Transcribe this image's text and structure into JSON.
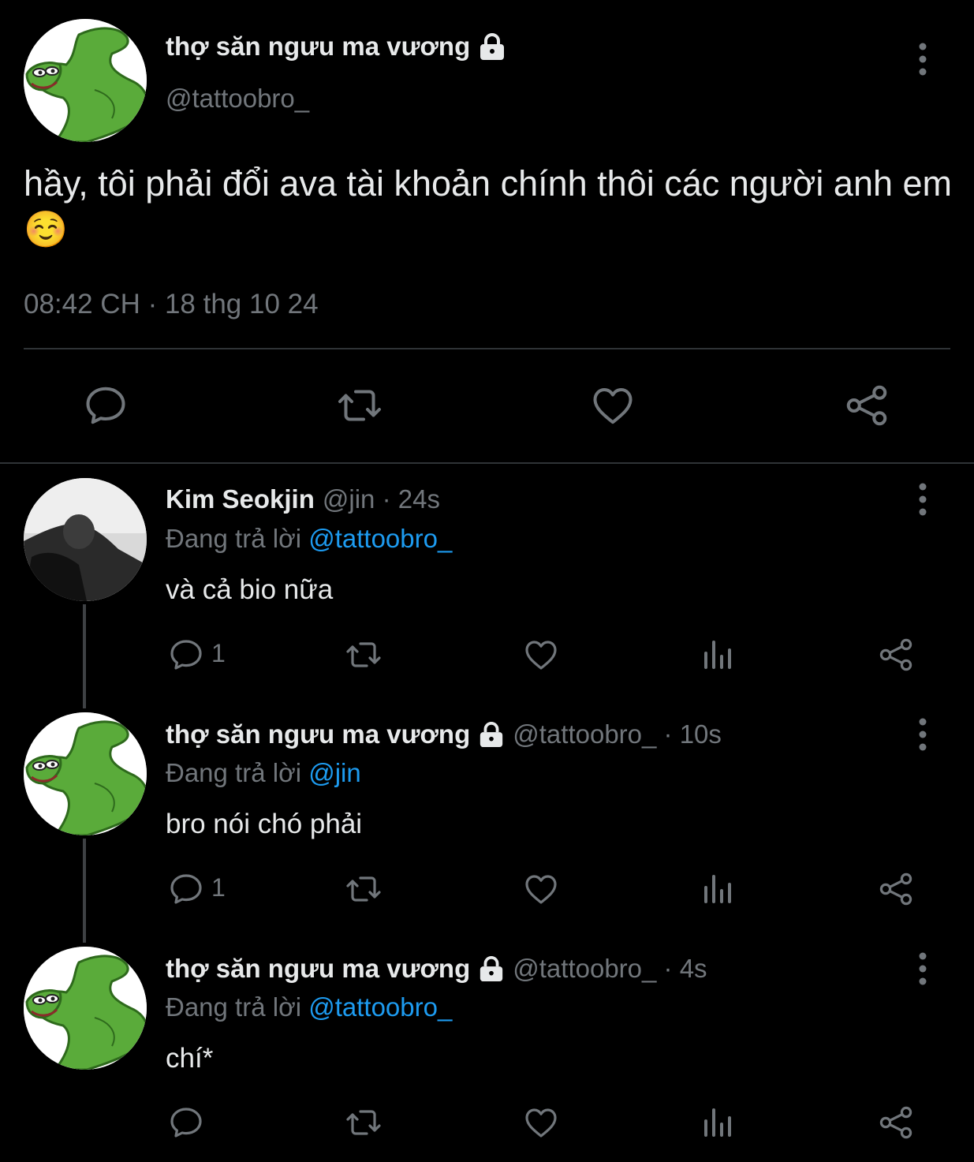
{
  "main_tweet": {
    "display_name": "thợ săn ngưu ma vương",
    "handle": "@tattoobro_",
    "text": "hầy, tôi phải đổi ava tài khoản chính thôi các người anh em ☺️",
    "timestamp": "08:42 CH · 18 thg 10 24",
    "avatar": "pepe-frog-icon",
    "locked_icon": "lock-icon"
  },
  "replies": [
    {
      "display_name": "Kim Seokjin",
      "meta": "@jin · 24s",
      "replying_label": "Đang trả lời",
      "replying_to": "@tattoobro_",
      "text": "và cả bio nữa",
      "reply_count": "1",
      "avatar": "grayscale-photo-avatar"
    },
    {
      "display_name": "thợ săn ngưu ma vương",
      "meta": "@tattoobro_ · 10s",
      "replying_label": "Đang trả lời",
      "replying_to": "@jin",
      "text": "bro nói chó phải",
      "reply_count": "1",
      "avatar": "pepe-frog-icon"
    },
    {
      "display_name": "thợ săn ngưu ma vương",
      "meta": "@tattoobro_ · 4s",
      "replying_label": "Đang trả lời",
      "replying_to": "@tattoobro_",
      "text": "chí*",
      "reply_count": "",
      "avatar": "pepe-frog-icon"
    }
  ],
  "colors": {
    "background": "#000000",
    "text": "#e7e9ea",
    "muted": "#71767b",
    "mention": "#1d9bf0",
    "divider": "#2f3336"
  }
}
